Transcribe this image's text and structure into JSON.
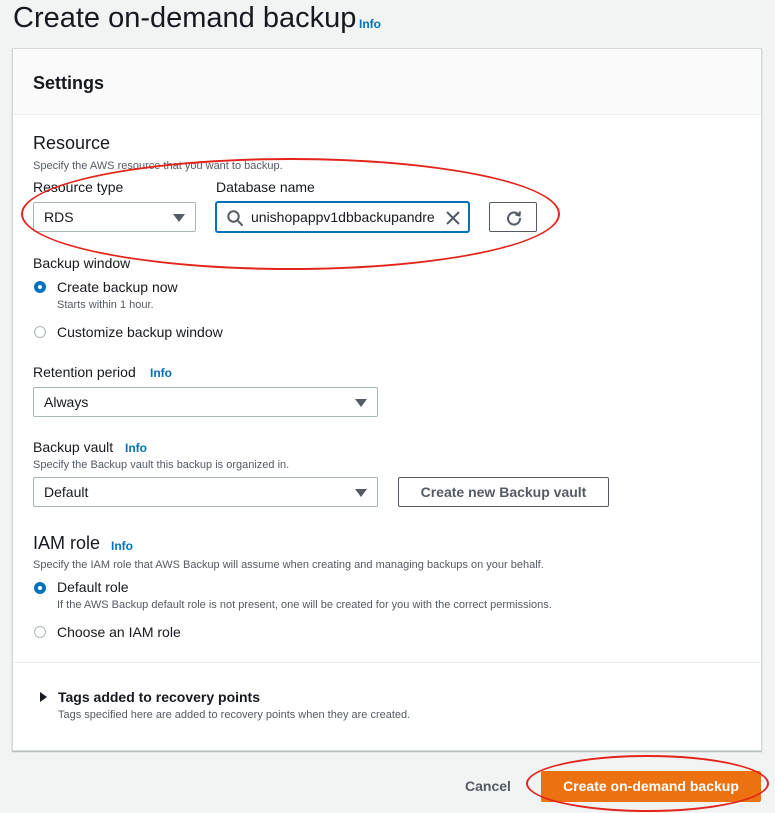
{
  "page": {
    "title": "Create on-demand backup",
    "info": "Info"
  },
  "settings": {
    "title": "Settings",
    "resource": {
      "heading": "Resource",
      "description": "Specify the AWS resource that you want to backup.",
      "type_label": "Resource type",
      "type_value": "RDS",
      "db_label": "Database name",
      "db_value": "unishopappv1dbbackupandre"
    },
    "backup_window": {
      "label": "Backup window",
      "options": [
        {
          "label": "Create backup now",
          "hint": "Starts within 1 hour.",
          "selected": true
        },
        {
          "label": "Customize backup window",
          "selected": false
        }
      ]
    },
    "retention": {
      "label": "Retention period",
      "info": "Info",
      "value": "Always"
    },
    "vault": {
      "label": "Backup vault",
      "info": "Info",
      "description": "Specify the Backup vault this backup is organized in.",
      "value": "Default",
      "create_button": "Create new Backup vault"
    },
    "iam": {
      "heading": "IAM role",
      "info": "Info",
      "description": "Specify the IAM role that AWS Backup will assume when creating and managing backups on your behalf.",
      "options": [
        {
          "label": "Default role",
          "hint": "If the AWS Backup default role is not present, one will be created for you with the correct permissions.",
          "selected": true
        },
        {
          "label": "Choose an IAM role",
          "selected": false
        }
      ]
    },
    "tags": {
      "label": "Tags added to recovery points",
      "description": "Tags specified here are added to recovery points when they are created."
    }
  },
  "footer": {
    "cancel": "Cancel",
    "submit": "Create on-demand backup"
  },
  "colors": {
    "primary": "#ec7211",
    "link": "#0073bb",
    "annotation": "#e3241b"
  },
  "icons": [
    "search-icon",
    "clear-icon",
    "refresh-icon",
    "caret-down-icon",
    "caret-right-icon"
  ]
}
